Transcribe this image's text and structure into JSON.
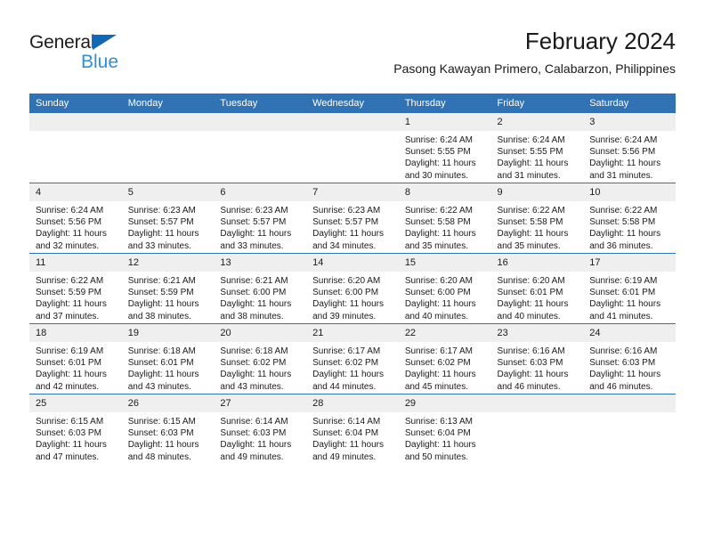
{
  "brand": {
    "name_part1": "General",
    "name_part2": "Blue",
    "triangle_icon": "triangle-logo-icon",
    "color_dark": "#1c1c1c",
    "color_blue": "#2f8fd8",
    "color_triangle": "#1268b3"
  },
  "header": {
    "title": "February 2024",
    "subtitle": "Pasong Kawayan Primero, Calabarzon, Philippines"
  },
  "theme": {
    "header_bg": "#3072b4",
    "header_text": "#ffffff",
    "daynum_bg": "#efefef",
    "cell_bg": "#ffffff",
    "row_divider": "#3072b4",
    "body_text": "#1a1a1a"
  },
  "weekday_headers": [
    "Sunday",
    "Monday",
    "Tuesday",
    "Wednesday",
    "Thursday",
    "Friday",
    "Saturday"
  ],
  "weeks": [
    [
      {
        "day": "",
        "blank": true,
        "sunrise": "",
        "sunset": "",
        "daylight_line1": "",
        "daylight_line2": ""
      },
      {
        "day": "",
        "blank": true,
        "sunrise": "",
        "sunset": "",
        "daylight_line1": "",
        "daylight_line2": ""
      },
      {
        "day": "",
        "blank": true,
        "sunrise": "",
        "sunset": "",
        "daylight_line1": "",
        "daylight_line2": ""
      },
      {
        "day": "",
        "blank": true,
        "sunrise": "",
        "sunset": "",
        "daylight_line1": "",
        "daylight_line2": ""
      },
      {
        "day": "1",
        "blank": false,
        "sunrise": "Sunrise: 6:24 AM",
        "sunset": "Sunset: 5:55 PM",
        "daylight_line1": "Daylight: 11 hours",
        "daylight_line2": "and 30 minutes."
      },
      {
        "day": "2",
        "blank": false,
        "sunrise": "Sunrise: 6:24 AM",
        "sunset": "Sunset: 5:55 PM",
        "daylight_line1": "Daylight: 11 hours",
        "daylight_line2": "and 31 minutes."
      },
      {
        "day": "3",
        "blank": false,
        "sunrise": "Sunrise: 6:24 AM",
        "sunset": "Sunset: 5:56 PM",
        "daylight_line1": "Daylight: 11 hours",
        "daylight_line2": "and 31 minutes."
      }
    ],
    [
      {
        "day": "4",
        "blank": false,
        "sunrise": "Sunrise: 6:24 AM",
        "sunset": "Sunset: 5:56 PM",
        "daylight_line1": "Daylight: 11 hours",
        "daylight_line2": "and 32 minutes."
      },
      {
        "day": "5",
        "blank": false,
        "sunrise": "Sunrise: 6:23 AM",
        "sunset": "Sunset: 5:57 PM",
        "daylight_line1": "Daylight: 11 hours",
        "daylight_line2": "and 33 minutes."
      },
      {
        "day": "6",
        "blank": false,
        "sunrise": "Sunrise: 6:23 AM",
        "sunset": "Sunset: 5:57 PM",
        "daylight_line1": "Daylight: 11 hours",
        "daylight_line2": "and 33 minutes."
      },
      {
        "day": "7",
        "blank": false,
        "sunrise": "Sunrise: 6:23 AM",
        "sunset": "Sunset: 5:57 PM",
        "daylight_line1": "Daylight: 11 hours",
        "daylight_line2": "and 34 minutes."
      },
      {
        "day": "8",
        "blank": false,
        "sunrise": "Sunrise: 6:22 AM",
        "sunset": "Sunset: 5:58 PM",
        "daylight_line1": "Daylight: 11 hours",
        "daylight_line2": "and 35 minutes."
      },
      {
        "day": "9",
        "blank": false,
        "sunrise": "Sunrise: 6:22 AM",
        "sunset": "Sunset: 5:58 PM",
        "daylight_line1": "Daylight: 11 hours",
        "daylight_line2": "and 35 minutes."
      },
      {
        "day": "10",
        "blank": false,
        "sunrise": "Sunrise: 6:22 AM",
        "sunset": "Sunset: 5:58 PM",
        "daylight_line1": "Daylight: 11 hours",
        "daylight_line2": "and 36 minutes."
      }
    ],
    [
      {
        "day": "11",
        "blank": false,
        "sunrise": "Sunrise: 6:22 AM",
        "sunset": "Sunset: 5:59 PM",
        "daylight_line1": "Daylight: 11 hours",
        "daylight_line2": "and 37 minutes."
      },
      {
        "day": "12",
        "blank": false,
        "sunrise": "Sunrise: 6:21 AM",
        "sunset": "Sunset: 5:59 PM",
        "daylight_line1": "Daylight: 11 hours",
        "daylight_line2": "and 38 minutes."
      },
      {
        "day": "13",
        "blank": false,
        "sunrise": "Sunrise: 6:21 AM",
        "sunset": "Sunset: 6:00 PM",
        "daylight_line1": "Daylight: 11 hours",
        "daylight_line2": "and 38 minutes."
      },
      {
        "day": "14",
        "blank": false,
        "sunrise": "Sunrise: 6:20 AM",
        "sunset": "Sunset: 6:00 PM",
        "daylight_line1": "Daylight: 11 hours",
        "daylight_line2": "and 39 minutes."
      },
      {
        "day": "15",
        "blank": false,
        "sunrise": "Sunrise: 6:20 AM",
        "sunset": "Sunset: 6:00 PM",
        "daylight_line1": "Daylight: 11 hours",
        "daylight_line2": "and 40 minutes."
      },
      {
        "day": "16",
        "blank": false,
        "sunrise": "Sunrise: 6:20 AM",
        "sunset": "Sunset: 6:01 PM",
        "daylight_line1": "Daylight: 11 hours",
        "daylight_line2": "and 40 minutes."
      },
      {
        "day": "17",
        "blank": false,
        "sunrise": "Sunrise: 6:19 AM",
        "sunset": "Sunset: 6:01 PM",
        "daylight_line1": "Daylight: 11 hours",
        "daylight_line2": "and 41 minutes."
      }
    ],
    [
      {
        "day": "18",
        "blank": false,
        "sunrise": "Sunrise: 6:19 AM",
        "sunset": "Sunset: 6:01 PM",
        "daylight_line1": "Daylight: 11 hours",
        "daylight_line2": "and 42 minutes."
      },
      {
        "day": "19",
        "blank": false,
        "sunrise": "Sunrise: 6:18 AM",
        "sunset": "Sunset: 6:01 PM",
        "daylight_line1": "Daylight: 11 hours",
        "daylight_line2": "and 43 minutes."
      },
      {
        "day": "20",
        "blank": false,
        "sunrise": "Sunrise: 6:18 AM",
        "sunset": "Sunset: 6:02 PM",
        "daylight_line1": "Daylight: 11 hours",
        "daylight_line2": "and 43 minutes."
      },
      {
        "day": "21",
        "blank": false,
        "sunrise": "Sunrise: 6:17 AM",
        "sunset": "Sunset: 6:02 PM",
        "daylight_line1": "Daylight: 11 hours",
        "daylight_line2": "and 44 minutes."
      },
      {
        "day": "22",
        "blank": false,
        "sunrise": "Sunrise: 6:17 AM",
        "sunset": "Sunset: 6:02 PM",
        "daylight_line1": "Daylight: 11 hours",
        "daylight_line2": "and 45 minutes."
      },
      {
        "day": "23",
        "blank": false,
        "sunrise": "Sunrise: 6:16 AM",
        "sunset": "Sunset: 6:03 PM",
        "daylight_line1": "Daylight: 11 hours",
        "daylight_line2": "and 46 minutes."
      },
      {
        "day": "24",
        "blank": false,
        "sunrise": "Sunrise: 6:16 AM",
        "sunset": "Sunset: 6:03 PM",
        "daylight_line1": "Daylight: 11 hours",
        "daylight_line2": "and 46 minutes."
      }
    ],
    [
      {
        "day": "25",
        "blank": false,
        "sunrise": "Sunrise: 6:15 AM",
        "sunset": "Sunset: 6:03 PM",
        "daylight_line1": "Daylight: 11 hours",
        "daylight_line2": "and 47 minutes."
      },
      {
        "day": "26",
        "blank": false,
        "sunrise": "Sunrise: 6:15 AM",
        "sunset": "Sunset: 6:03 PM",
        "daylight_line1": "Daylight: 11 hours",
        "daylight_line2": "and 48 minutes."
      },
      {
        "day": "27",
        "blank": false,
        "sunrise": "Sunrise: 6:14 AM",
        "sunset": "Sunset: 6:03 PM",
        "daylight_line1": "Daylight: 11 hours",
        "daylight_line2": "and 49 minutes."
      },
      {
        "day": "28",
        "blank": false,
        "sunrise": "Sunrise: 6:14 AM",
        "sunset": "Sunset: 6:04 PM",
        "daylight_line1": "Daylight: 11 hours",
        "daylight_line2": "and 49 minutes."
      },
      {
        "day": "29",
        "blank": false,
        "sunrise": "Sunrise: 6:13 AM",
        "sunset": "Sunset: 6:04 PM",
        "daylight_line1": "Daylight: 11 hours",
        "daylight_line2": "and 50 minutes."
      },
      {
        "day": "",
        "blank": true,
        "sunrise": "",
        "sunset": "",
        "daylight_line1": "",
        "daylight_line2": ""
      },
      {
        "day": "",
        "blank": true,
        "sunrise": "",
        "sunset": "",
        "daylight_line1": "",
        "daylight_line2": ""
      }
    ]
  ]
}
